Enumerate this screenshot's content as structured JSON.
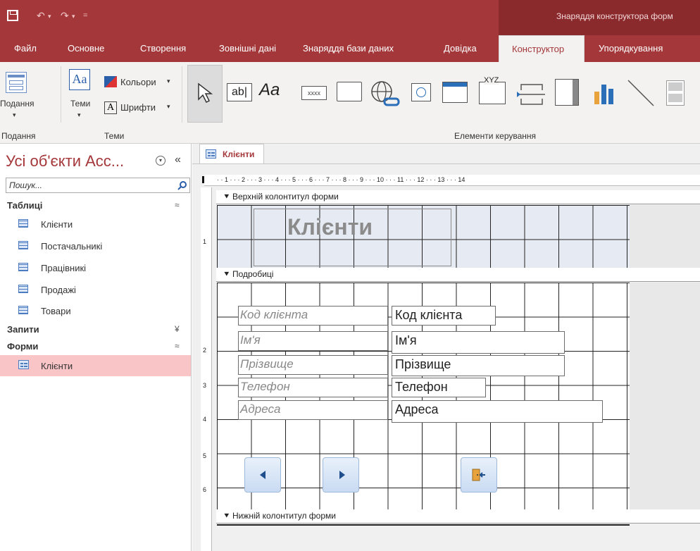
{
  "window": {
    "context_title": "Знаряддя конструктора форм"
  },
  "tabs": [
    "Файл",
    "Основне",
    "Створення",
    "Зовнішні дані",
    "Знаряддя бази даних",
    "Довідка",
    "Конструктор",
    "Упорядкування"
  ],
  "active_tab": "Конструктор",
  "ribbon": {
    "view_label": "Подання",
    "themes_label": "Теми",
    "colors_label": "Кольори",
    "fonts_label": "Шрифти",
    "group_view": "Подання",
    "group_themes": "Теми",
    "group_controls": "Елементи керування",
    "textbox_text": "ab|",
    "label_text": "Aa",
    "xxxx_text": "xxxx",
    "xyz_text": "XYZ"
  },
  "nav": {
    "title": "Усі об'єкти Acc...",
    "search_placeholder": "Пошук...",
    "groups": {
      "tables": "Таблиці",
      "queries": "Запити",
      "forms": "Форми"
    },
    "tables": [
      "Клієнти",
      "Постачальникі",
      "Працівникі",
      "Продажі",
      "Товари"
    ],
    "forms": [
      "Клієнти"
    ]
  },
  "designer": {
    "tab_label": "Клієнти",
    "ruler_text": "· · 1 · · · 2 · · · 3 · · · 4 · · · 5 · · · 6 · · · 7 · · · 8 · · · 9 · · · 10 · · · 11 · · · 12 · · · 13 · · · 14",
    "ruler_v": [
      "1",
      "2",
      "3",
      "4",
      "5",
      "6"
    ],
    "header_section": "Верхній колонтитул форми",
    "header_title": "Клієнти",
    "detail_section": "Подробиці",
    "footer_section": "Нижній колонтитул форми",
    "fields": [
      {
        "label": "Код клієнта",
        "value": "Код клієнта"
      },
      {
        "label": "Ім'я",
        "value": "Ім'я"
      },
      {
        "label": "Прізвище",
        "value": "Прізвище"
      },
      {
        "label": "Телефон",
        "value": "Телефон"
      },
      {
        "label": "Адреса",
        "value": "Адреса"
      }
    ]
  }
}
